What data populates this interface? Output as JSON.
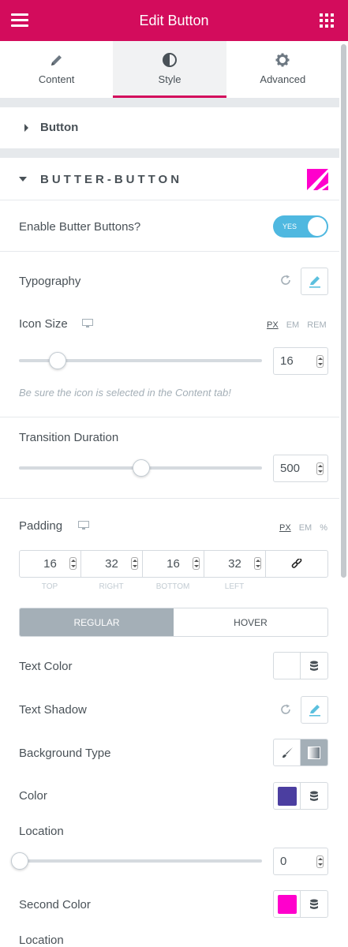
{
  "header": {
    "title": "Edit Button"
  },
  "tabs": [
    {
      "label": "Content",
      "icon": "pencil-icon"
    },
    {
      "label": "Style",
      "icon": "contrast-icon"
    },
    {
      "label": "Advanced",
      "icon": "gear-icon"
    }
  ],
  "sections": {
    "button": "Button",
    "butter": "BUTTER-BUTTON"
  },
  "butter": {
    "enable_label": "Enable Butter Buttons?",
    "enable_toggle": "YES",
    "typography_label": "Typography",
    "icon_size_label": "Icon Size",
    "icon_size_units": [
      "PX",
      "EM",
      "REM"
    ],
    "icon_size_value": "16",
    "icon_size_note": "Be sure the icon is selected in the Content tab!",
    "transition_label": "Transition Duration",
    "transition_value": "500",
    "padding_label": "Padding",
    "padding_units": [
      "PX",
      "EM",
      "%"
    ],
    "padding": [
      {
        "value": "16",
        "label": "TOP"
      },
      {
        "value": "32",
        "label": "RIGHT"
      },
      {
        "value": "16",
        "label": "BOTTOM"
      },
      {
        "value": "32",
        "label": "LEFT"
      }
    ],
    "state_tabs": [
      "REGULAR",
      "HOVER"
    ],
    "text_color_label": "Text Color",
    "text_shadow_label": "Text Shadow",
    "bg_type_label": "Background Type",
    "color_label": "Color",
    "color_value": "#4b3ea0",
    "location_label": "Location",
    "location_value": "0",
    "second_color_label": "Second Color",
    "second_color_value": "#ff00cc",
    "location2_label": "Location"
  },
  "colors": {
    "brand": "#d30c5c",
    "toggle_on": "#4fb8e0",
    "accent_icon": "#5bc0de"
  }
}
